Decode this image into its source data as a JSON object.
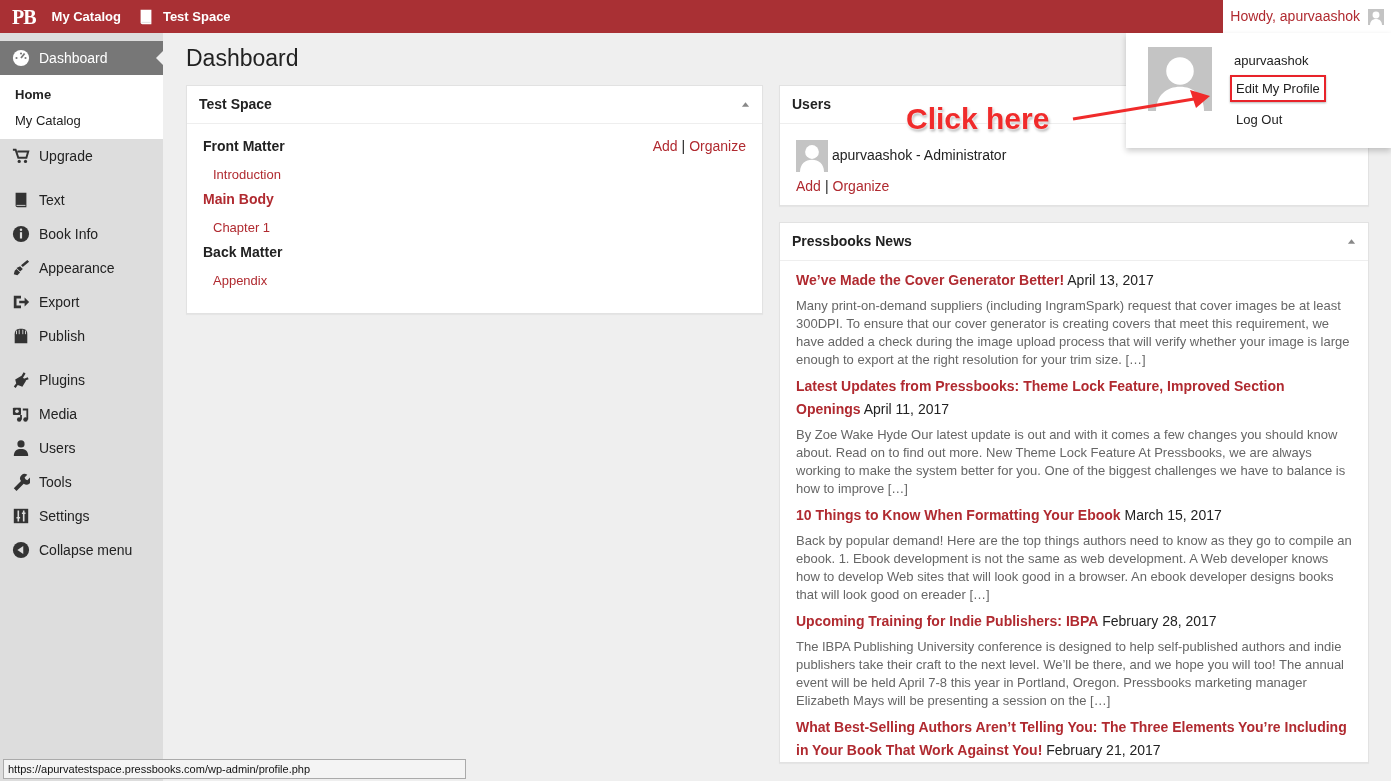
{
  "admin_bar": {
    "logo": "PB",
    "items": [
      {
        "label": "My Catalog"
      },
      {
        "label": "Test Space"
      }
    ],
    "account": "Howdy, apurvaashok"
  },
  "account_menu": {
    "username": "apurvaashok",
    "items": [
      {
        "label": "Edit My Profile",
        "highlighted": true
      },
      {
        "label": "Log Out",
        "highlighted": false
      }
    ]
  },
  "sidebar": {
    "groups": [
      {
        "items": [
          {
            "label": "Dashboard",
            "selected": true,
            "children": [
              {
                "label": "Home",
                "selected": true
              },
              {
                "label": "My Catalog",
                "selected": false
              }
            ]
          },
          {
            "label": "Upgrade",
            "selected": false
          }
        ]
      },
      {
        "items": [
          {
            "label": "Text",
            "selected": false
          },
          {
            "label": "Book Info",
            "selected": false
          },
          {
            "label": "Appearance",
            "selected": false
          },
          {
            "label": "Export",
            "selected": false
          },
          {
            "label": "Publish",
            "selected": false
          }
        ]
      },
      {
        "items": [
          {
            "label": "Plugins",
            "selected": false
          },
          {
            "label": "Media",
            "selected": false
          },
          {
            "label": "Users",
            "selected": false
          },
          {
            "label": "Tools",
            "selected": false
          },
          {
            "label": "Settings",
            "selected": false
          },
          {
            "label": "Collapse menu",
            "selected": false
          }
        ]
      }
    ]
  },
  "page_title": "Dashboard",
  "book_widget": {
    "title": "Test Space",
    "actions": [
      "Add",
      "Organize"
    ],
    "action_separator": "|",
    "sections": [
      {
        "label": "Front Matter",
        "linked": false,
        "chapters": [
          "Introduction"
        ]
      },
      {
        "label": "Main Body",
        "linked": true,
        "chapters": [
          "Chapter 1"
        ]
      },
      {
        "label": "Back Matter",
        "linked": false,
        "chapters": [
          "Appendix"
        ]
      }
    ]
  },
  "users_widget": {
    "title": "Users",
    "users": [
      "apurvaashok - Administrator"
    ],
    "actions": [
      "Add",
      "Organize"
    ],
    "action_separator": "|"
  },
  "news_widget": {
    "title": "Pressbooks News",
    "items": [
      {
        "title": "We’ve Made the Cover Generator Better!",
        "date": "April 13, 2017",
        "excerpt": "Many print-on-demand suppliers (including IngramSpark) request that cover images be at least 300DPI. To ensure that our cover generator is creating covers that meet this requirement, we have added a check during the image upload process that will verify whether your image is large enough to export at the right resolution for your trim size. […]"
      },
      {
        "title": "Latest Updates from Pressbooks: Theme Lock Feature, Improved Section Openings",
        "date": "April 11, 2017",
        "excerpt": "By Zoe Wake Hyde Our latest update is out and with it comes a few changes you should know about. Read on to find out more. New Theme Lock Feature At Pressbooks, we are always working to make the system better for you. One of the biggest challenges we have to balance is how to improve […]"
      },
      {
        "title": "10 Things to Know When Formatting Your Ebook",
        "date": "March 15, 2017",
        "excerpt": "Back by popular demand! Here are the top things authors need to know as they go to compile an ebook. 1. Ebook development is not the same as web development. A Web developer knows how to develop Web sites that will look good in a browser. An ebook developer designs books that will look good on ereader […]"
      },
      {
        "title": "Upcoming Training for Indie Publishers: IBPA",
        "date": "February 28, 2017",
        "excerpt": "The IBPA Publishing University conference is designed to help self-published authors and indie publishers take their craft to the next level. We’ll be there, and we hope you will too! The annual event will be held April 7-8 this year in Portland, Oregon. Pressbooks marketing manager Elizabeth Mays will be presenting a session on the […]"
      },
      {
        "title": "What Best-Selling Authors Aren’t Telling You: The Three Elements You’re Including in Your Book That Work Against You!",
        "date": "February 21, 2017"
      }
    ]
  },
  "annotation": {
    "text": "Click here"
  },
  "status_url": "https://apurvatestspace.pressbooks.com/wp-admin/profile.php"
}
